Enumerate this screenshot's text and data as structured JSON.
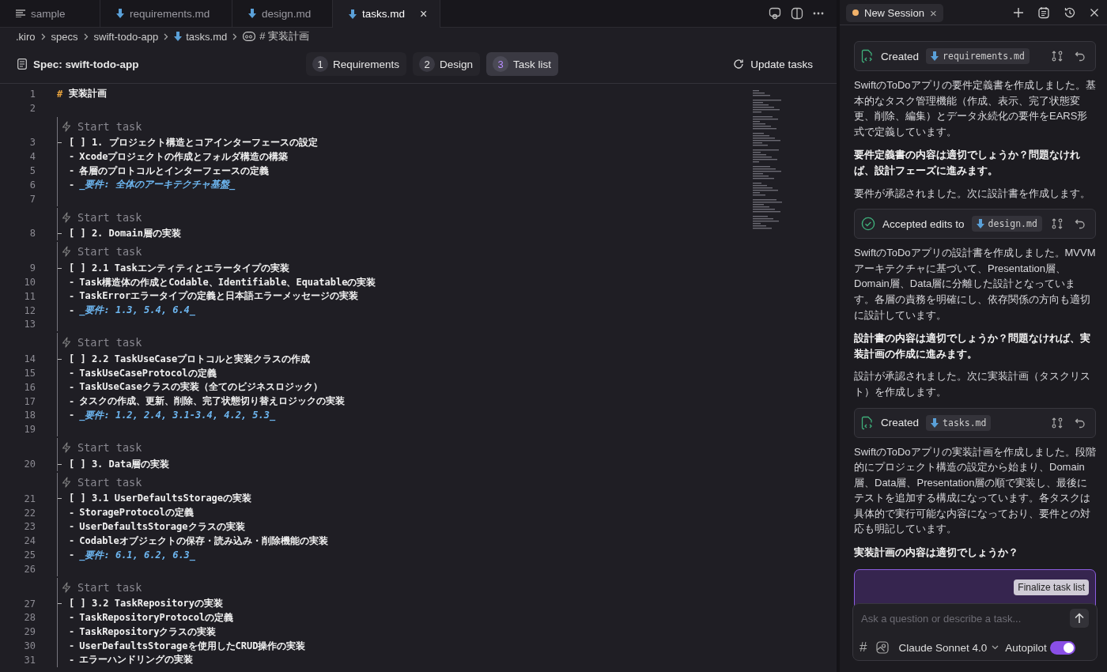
{
  "tabs": [
    {
      "label": "sample",
      "kind": "text",
      "selected": false
    },
    {
      "label": "requirements.md",
      "kind": "markdown",
      "selected": false
    },
    {
      "label": "design.md",
      "kind": "markdown",
      "selected": false
    },
    {
      "label": "tasks.md",
      "kind": "markdown",
      "selected": true,
      "close": "×"
    }
  ],
  "breadcrumb": [
    {
      "label": ".kiro",
      "kind": "folder"
    },
    {
      "label": "specs",
      "kind": "folder"
    },
    {
      "label": "swift-todo-app",
      "kind": "folder"
    },
    {
      "label": "tasks.md",
      "kind": "markdown"
    },
    {
      "label": "# 実装計画",
      "kind": "symbol"
    }
  ],
  "spec_bar": {
    "title": "Spec: swift-todo-app",
    "steps": [
      {
        "number": "1",
        "label": "Requirements",
        "selected": false
      },
      {
        "number": "2",
        "label": "Design",
        "selected": false
      },
      {
        "number": "3",
        "label": "Task list",
        "selected": true
      }
    ],
    "action": "Update tasks"
  },
  "editor": {
    "lines": [
      {
        "number": "1",
        "kind": "heading",
        "marker": "#",
        "text": "実装計画"
      },
      {
        "number": "2",
        "kind": "blank"
      }
    ],
    "blocks": [
      {
        "codelens": "Start task",
        "lines": [
          {
            "number": "3",
            "kind": "task",
            "text": "[ ] 1. プロジェクト構造とコアインターフェースの設定"
          },
          {
            "number": "4",
            "kind": "bullet",
            "marker": "-",
            "text": "Xcodeプロジェクトの作成とフォルダ構造の構築"
          },
          {
            "number": "5",
            "kind": "bullet",
            "marker": "-",
            "text": "各層のプロトコルとインターフェースの定義"
          },
          {
            "number": "6",
            "kind": "req",
            "marker": "-",
            "text": "_要件: 全体のアーキテクチャ基盤_"
          },
          {
            "number": "7",
            "kind": "blank"
          }
        ]
      },
      {
        "codelens": "Start task",
        "lines": [
          {
            "number": "8",
            "kind": "task",
            "text": "[ ] 2. Domain層の実装"
          }
        ]
      },
      {
        "codelens": "Start task",
        "lines": [
          {
            "number": "9",
            "kind": "task",
            "text": "[ ] 2.1 Taskエンティティとエラータイプの実装"
          },
          {
            "number": "10",
            "kind": "bullet",
            "marker": "-",
            "text": "Task構造体の作成とCodable、Identifiable、Equatableの実装"
          },
          {
            "number": "11",
            "kind": "bullet",
            "marker": "-",
            "text": "TaskErrorエラータイプの定義と日本語エラーメッセージの実装"
          },
          {
            "number": "12",
            "kind": "req",
            "marker": "-",
            "text": "_要件: 1.3, 5.4, 6.4_"
          },
          {
            "number": "13",
            "kind": "blank"
          }
        ]
      },
      {
        "codelens": "Start task",
        "lines": [
          {
            "number": "14",
            "kind": "task",
            "text": "[ ] 2.2 TaskUseCaseプロトコルと実装クラスの作成"
          },
          {
            "number": "15",
            "kind": "bullet",
            "marker": "-",
            "text": "TaskUseCaseProtocolの定義"
          },
          {
            "number": "16",
            "kind": "bullet",
            "marker": "-",
            "text": "TaskUseCaseクラスの実装（全てのビジネスロジック）"
          },
          {
            "number": "17",
            "kind": "bullet",
            "marker": "-",
            "text": "タスクの作成、更新、削除、完了状態切り替えロジックの実装"
          },
          {
            "number": "18",
            "kind": "req",
            "marker": "-",
            "text": "_要件: 1.2, 2.4, 3.1-3.4, 4.2, 5.3_"
          },
          {
            "number": "19",
            "kind": "blank"
          }
        ]
      },
      {
        "codelens": "Start task",
        "lines": [
          {
            "number": "20",
            "kind": "task",
            "text": "[ ] 3. Data層の実装"
          }
        ]
      },
      {
        "codelens": "Start task",
        "lines": [
          {
            "number": "21",
            "kind": "task",
            "text": "[ ] 3.1 UserDefaultsStorageの実装"
          },
          {
            "number": "22",
            "kind": "bullet",
            "marker": "-",
            "text": "StorageProtocolの定義"
          },
          {
            "number": "23",
            "kind": "bullet",
            "marker": "-",
            "text": "UserDefaultsStorageクラスの実装"
          },
          {
            "number": "24",
            "kind": "bullet",
            "marker": "-",
            "text": "Codableオブジェクトの保存・読み込み・削除機能の実装"
          },
          {
            "number": "25",
            "kind": "req",
            "marker": "-",
            "text": "_要件: 6.1, 6.2, 6.3_"
          },
          {
            "number": "26",
            "kind": "blank"
          }
        ]
      },
      {
        "codelens": "Start task",
        "lines": [
          {
            "number": "27",
            "kind": "task",
            "text": "[ ] 3.2 TaskRepositoryの実装"
          },
          {
            "number": "28",
            "kind": "bullet",
            "marker": "-",
            "text": "TaskRepositoryProtocolの定義"
          },
          {
            "number": "29",
            "kind": "bullet",
            "marker": "-",
            "text": "TaskRepositoryクラスの実装"
          },
          {
            "number": "30",
            "kind": "bullet",
            "marker": "-",
            "text": "UserDefaultsStorageを使用したCRUD操作の実装"
          },
          {
            "number": "31",
            "kind": "bullet",
            "marker": "-",
            "text": "エラーハンドリングの実装"
          }
        ]
      }
    ]
  },
  "chat": {
    "session": {
      "title": "New Session",
      "close": "×"
    },
    "messages": [
      {
        "kind": "created",
        "label": "Created",
        "file": "requirements.md"
      },
      {
        "kind": "text",
        "text": "SwiftのToDoアプリの要件定義書を作成しました。基本的なタスク管理機能（作成、表示、完了状態変更、削除、編集）とデータ永続化の要件をEARS形式で定義しています。"
      },
      {
        "kind": "bold",
        "text": "要件定義書の内容は適切でしょうか？問題なければ、設計フェーズに進みます。"
      },
      {
        "kind": "text",
        "text": "要件が承認されました。次に設計書を作成します。"
      },
      {
        "kind": "accepted",
        "label": "Accepted edits to",
        "file": "design.md"
      },
      {
        "kind": "text",
        "text": "SwiftのToDoアプリの設計書を作成しました。MVVMアーキテクチャに基づいて、Presentation層、Domain層、Data層に分離した設計となっています。各層の責務を明確にし、依存関係の方向も適切に設計しています。"
      },
      {
        "kind": "bold",
        "text": "設計書の内容は適切でしょうか？問題なければ、実装計画の作成に進みます。"
      },
      {
        "kind": "text",
        "text": "設計が承認されました。次に実装計画（タスクリスト）を作成します。"
      },
      {
        "kind": "created",
        "label": "Created",
        "file": "tasks.md"
      },
      {
        "kind": "text",
        "text": "SwiftのToDoアプリの実装計画を作成しました。段階的にプロジェクト構造の設定から始まり、Domain層、Data層、Presentation層の順で実装し、最後にテストを追加する構成になっています。各タスクは具体的で実行可能な内容になっており、要件との対応も明記しています。"
      },
      {
        "kind": "bold",
        "text": "実装計画の内容は適切でしょうか？"
      }
    ],
    "finalize_button": "Finalize task list",
    "composer": {
      "placeholder": "Ask a question or describe a task...",
      "hash": "#",
      "model": "Claude Sonnet 4.0",
      "autopilot_label": "Autopilot",
      "autopilot_on": true
    }
  }
}
